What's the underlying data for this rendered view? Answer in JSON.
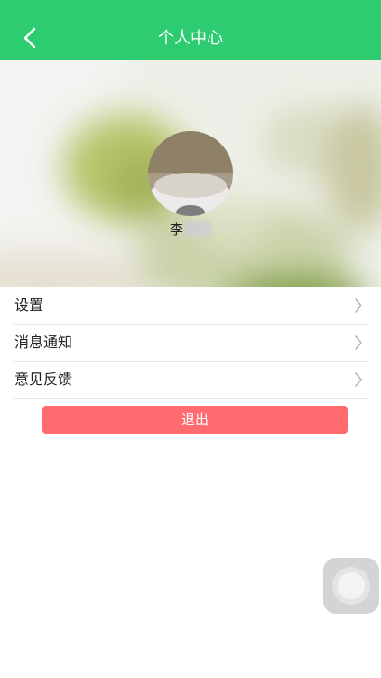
{
  "header": {
    "title": "个人中心",
    "back_icon": "chevron-left-icon",
    "color": "#2ecc71"
  },
  "profile": {
    "name_visible": "李",
    "name_redacted": true
  },
  "menu": {
    "items": [
      {
        "label": "设置",
        "icon": "chevron-right-icon"
      },
      {
        "label": "消息通知",
        "icon": "chevron-right-icon"
      },
      {
        "label": "意见反馈",
        "icon": "chevron-right-icon"
      }
    ]
  },
  "logout": {
    "label": "退出",
    "color": "#ff6b6f"
  },
  "floating": {
    "icon": "assistive-touch-icon"
  }
}
